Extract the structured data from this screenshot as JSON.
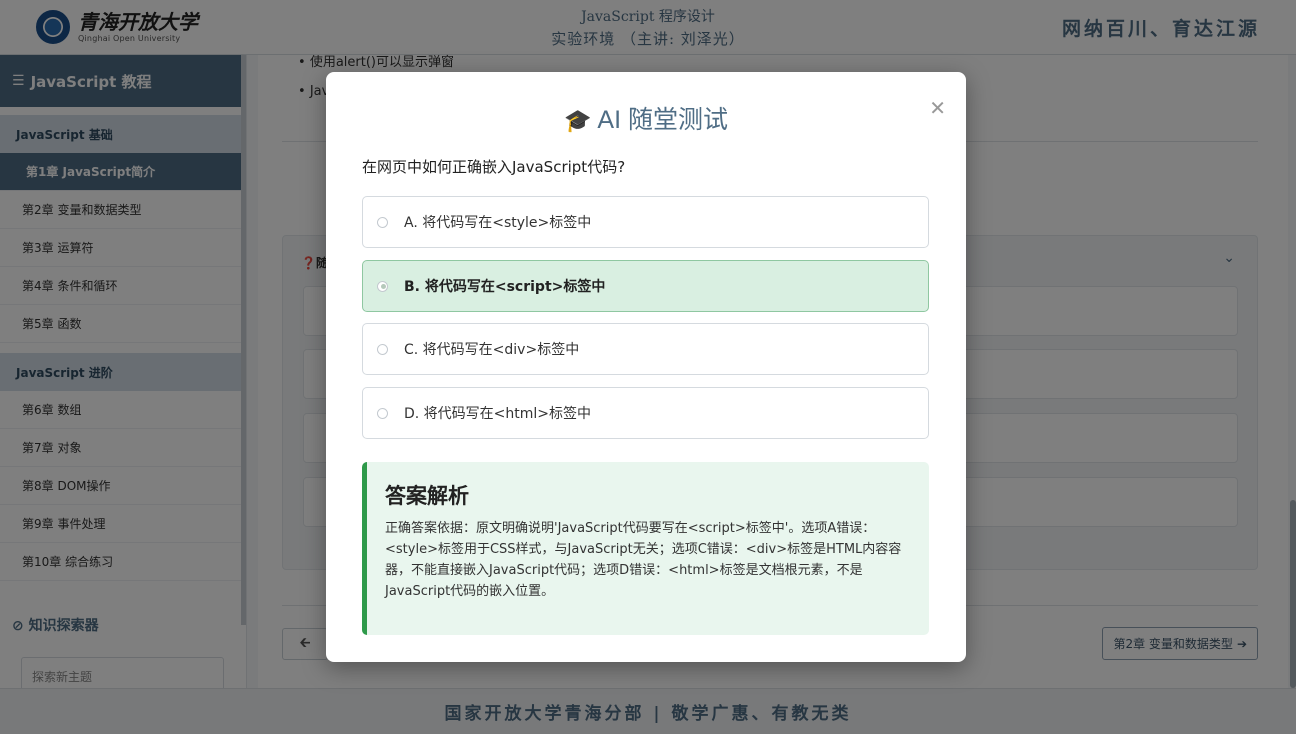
{
  "header": {
    "logo_cn": "青海开放大学",
    "logo_en": "Qinghai Open University",
    "title_line1": "JavaScript 程序设计",
    "title_line2": "实验环境 （主讲: 刘泽光）",
    "motto": "网纳百川、育达江源"
  },
  "sidebar": {
    "title": "JavaScript 教程",
    "groups": [
      {
        "label": "JavaScript 基础",
        "items": [
          "第1章 JavaScript简介",
          "第2章 变量和数据类型",
          "第3章 运算符",
          "第4章 条件和循环",
          "第5章 函数"
        ]
      },
      {
        "label": "JavaScript 进阶",
        "items": [
          "第6章 数组",
          "第7章 对象",
          "第8章 DOM操作",
          "第9章 事件处理",
          "第10章 综合练习"
        ]
      }
    ],
    "active_item": "第1章 JavaScript简介",
    "explorer_label": "知识探索器",
    "explorer_placeholder": "探索新主题"
  },
  "main": {
    "bullet1": "使用alert()可以显示弹窗",
    "bullet2": "Jav",
    "quiz_label": "随",
    "next_label": "第2章 变量和数据类型"
  },
  "footer": {
    "text": "国家开放大学青海分部 | 敬学广惠、有教无类"
  },
  "modal": {
    "title": "AI 随堂测试",
    "question": "在网页中如何正确嵌入JavaScript代码?",
    "options": [
      "A. 将代码写在<style>标签中",
      "B. 将代码写在<script>标签中",
      "C. 将代码写在<div>标签中",
      "D. 将代码写在<html>标签中"
    ],
    "selected_index": 1,
    "explain_title": "答案解析",
    "explain_body": "正确答案依据：原文明确说明'JavaScript代码要写在<script>标签中'。选项A错误：<style>标签用于CSS样式，与JavaScript无关；选项C错误：<div>标签是HTML内容容器，不能直接嵌入JavaScript代码；选项D错误：<html>标签是文档根元素，不是JavaScript代码的嵌入位置。"
  }
}
